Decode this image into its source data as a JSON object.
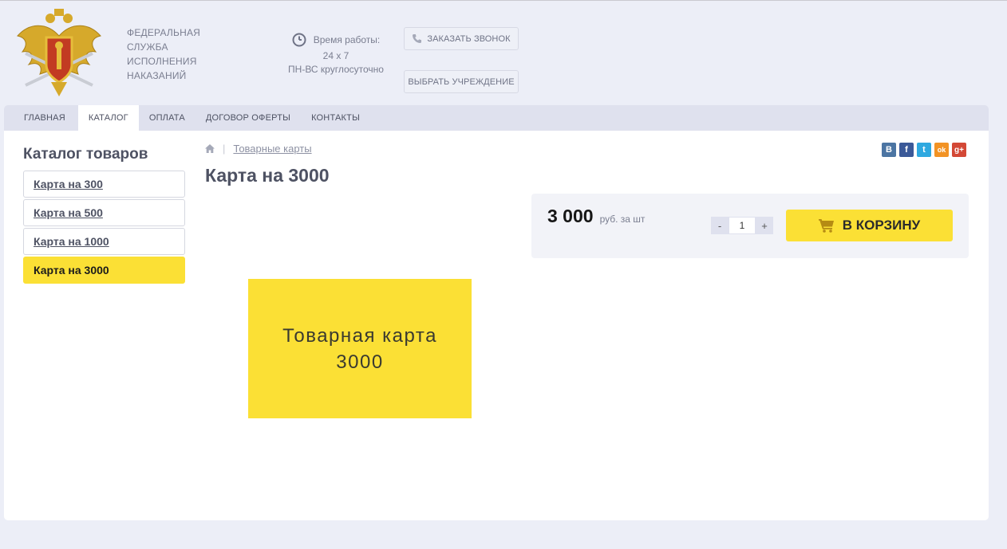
{
  "header": {
    "org_name": [
      "ФЕДЕРАЛЬНАЯ",
      "СЛУЖБА",
      "ИСПОЛНЕНИЯ",
      "НАКАЗАНИЙ"
    ],
    "hours_label": "Время работы:",
    "hours_line1": "24 x 7",
    "hours_line2": "ПН-ВС круглосуточно",
    "call_button": "ЗАКАЗАТЬ ЗВОНОК",
    "institution_button": "ВЫБРАТЬ УЧРЕЖДЕНИЕ"
  },
  "nav": {
    "items": [
      {
        "label": "ГЛАВНАЯ"
      },
      {
        "label": "КАТАЛОГ"
      },
      {
        "label": "ОПЛАТА"
      },
      {
        "label": "ДОГОВОР ОФЕРТЫ"
      },
      {
        "label": "КОНТАКТЫ"
      }
    ],
    "active_index": 1
  },
  "sidebar": {
    "title": "Каталог товаров",
    "items": [
      {
        "label": "Карта на 300"
      },
      {
        "label": "Карта на 500"
      },
      {
        "label": "Карта на 1000"
      },
      {
        "label": "Карта на 3000"
      }
    ],
    "active_index": 3
  },
  "breadcrumb": {
    "sep": "|",
    "link": "Товарные карты"
  },
  "share": {
    "vk": "B",
    "facebook": "f",
    "twitter": "t",
    "odnoklassniki": "ok",
    "googleplus": "g+"
  },
  "product": {
    "title": "Карта на 3000",
    "image_line1": "Товарная карта",
    "image_line2": "3000",
    "price": "3 000",
    "price_unit": "руб. за шт",
    "qty_minus": "-",
    "qty_value": "1",
    "qty_plus": "+",
    "cart_button": "В КОРЗИНУ"
  },
  "colors": {
    "accent_yellow": "#fbe035",
    "nav_bg": "#dfe1ee",
    "page_bg": "#eceef7",
    "text": "#4e5263"
  }
}
